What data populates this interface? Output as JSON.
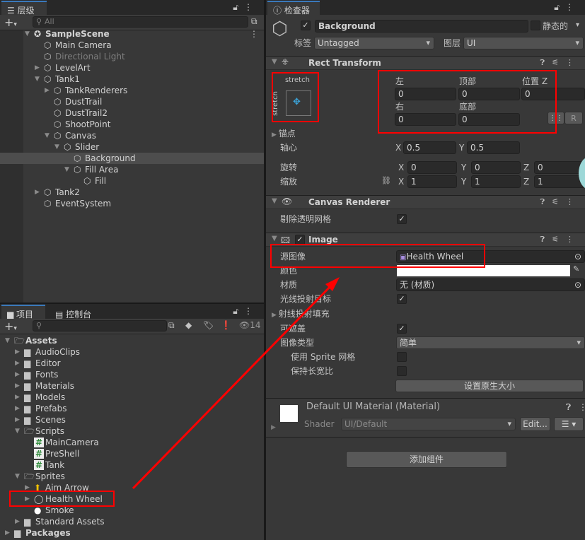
{
  "hierarchy": {
    "tab": "层级",
    "search_placeholder": "All",
    "items": [
      {
        "label": "SampleScene",
        "depth": 0,
        "arrow": "open",
        "icon": "unity-scene-icon",
        "bold": true
      },
      {
        "label": "Main Camera",
        "depth": 1,
        "arrow": "none",
        "icon": "gameobject-cube-icon"
      },
      {
        "label": "Directional Light",
        "depth": 1,
        "arrow": "none",
        "icon": "gameobject-cube-icon",
        "dim": true
      },
      {
        "label": "LevelArt",
        "depth": 1,
        "arrow": "closed",
        "icon": "gameobject-cube-icon"
      },
      {
        "label": "Tank1",
        "depth": 1,
        "arrow": "open",
        "icon": "gameobject-cube-icon"
      },
      {
        "label": "TankRenderers",
        "depth": 2,
        "arrow": "closed",
        "icon": "gameobject-cube-icon"
      },
      {
        "label": "DustTrail",
        "depth": 2,
        "arrow": "none",
        "icon": "gameobject-cube-icon"
      },
      {
        "label": "DustTrail2",
        "depth": 2,
        "arrow": "none",
        "icon": "gameobject-cube-icon"
      },
      {
        "label": "ShootPoint",
        "depth": 2,
        "arrow": "none",
        "icon": "gameobject-cube-icon"
      },
      {
        "label": "Canvas",
        "depth": 2,
        "arrow": "open",
        "icon": "gameobject-cube-icon"
      },
      {
        "label": "Slider",
        "depth": 3,
        "arrow": "open",
        "icon": "gameobject-cube-icon"
      },
      {
        "label": "Background",
        "depth": 4,
        "arrow": "none",
        "icon": "gameobject-cube-icon",
        "selected": true
      },
      {
        "label": "Fill Area",
        "depth": 4,
        "arrow": "open",
        "icon": "gameobject-cube-icon"
      },
      {
        "label": "Fill",
        "depth": 5,
        "arrow": "none",
        "icon": "gameobject-cube-icon"
      },
      {
        "label": "Tank2",
        "depth": 1,
        "arrow": "closed",
        "icon": "gameobject-cube-icon"
      },
      {
        "label": "EventSystem",
        "depth": 1,
        "arrow": "none",
        "icon": "gameobject-cube-icon"
      }
    ]
  },
  "project": {
    "tabs": [
      "项目",
      "控制台"
    ],
    "hidden_count": "14",
    "items": [
      {
        "label": "Assets",
        "depth": 0,
        "arrow": "open",
        "icon": "folder-open-icon",
        "bold": true
      },
      {
        "label": "AudioClips",
        "depth": 1,
        "arrow": "closed",
        "icon": "folder-icon"
      },
      {
        "label": "Editor",
        "depth": 1,
        "arrow": "closed",
        "icon": "folder-icon"
      },
      {
        "label": "Fonts",
        "depth": 1,
        "arrow": "closed",
        "icon": "folder-icon"
      },
      {
        "label": "Materials",
        "depth": 1,
        "arrow": "closed",
        "icon": "folder-icon"
      },
      {
        "label": "Models",
        "depth": 1,
        "arrow": "closed",
        "icon": "folder-icon"
      },
      {
        "label": "Prefabs",
        "depth": 1,
        "arrow": "closed",
        "icon": "folder-icon"
      },
      {
        "label": "Scenes",
        "depth": 1,
        "arrow": "closed",
        "icon": "folder-icon"
      },
      {
        "label": "Scripts",
        "depth": 1,
        "arrow": "open",
        "icon": "folder-open-icon"
      },
      {
        "label": "MainCamera",
        "depth": 2,
        "arrow": "none",
        "icon": "csharp-script-icon"
      },
      {
        "label": "PreShell",
        "depth": 2,
        "arrow": "none",
        "icon": "csharp-script-icon"
      },
      {
        "label": "Tank",
        "depth": 2,
        "arrow": "none",
        "icon": "csharp-script-icon"
      },
      {
        "label": "Sprites",
        "depth": 1,
        "arrow": "open",
        "icon": "folder-open-icon"
      },
      {
        "label": "Aim Arrow",
        "depth": 2,
        "arrow": "closed",
        "icon": "arrow-sprite-icon"
      },
      {
        "label": "Health Wheel",
        "depth": 2,
        "arrow": "closed",
        "icon": "ring-sprite-icon"
      },
      {
        "label": "Smoke",
        "depth": 2,
        "arrow": "none",
        "icon": "circle-sprite-icon"
      },
      {
        "label": "Standard Assets",
        "depth": 1,
        "arrow": "closed",
        "icon": "folder-icon"
      },
      {
        "label": "Packages",
        "depth": 0,
        "arrow": "closed",
        "icon": "folder-icon",
        "bold": true
      }
    ]
  },
  "inspector": {
    "tab": "检查器",
    "object_name": "Background",
    "active": true,
    "static_label": "静态的",
    "tag_label": "标签",
    "tag_value": "Untagged",
    "layer_label": "图层",
    "layer_value": "UI",
    "rect": {
      "title": "Rect Transform",
      "anchor_h": "stretch",
      "anchor_v": "stretch",
      "left_label": "左",
      "left": "0",
      "top_label": "顶部",
      "top": "0",
      "posz_label": "位置 Z",
      "posz": "0",
      "right_label": "右",
      "right": "0",
      "bottom_label": "底部",
      "bottom": "0",
      "r_button": "R",
      "anchors_label": "锚点",
      "pivot_label": "轴心",
      "pivot_x": "0.5",
      "pivot_y": "0.5",
      "rotation_label": "旋转",
      "rot_x": "0",
      "rot_y": "0",
      "rot_z": "0",
      "scale_label": "缩放",
      "scale_x": "1",
      "scale_y": "1",
      "scale_z": "1",
      "x": "X",
      "y": "Y",
      "z": "Z"
    },
    "canvas_renderer": {
      "title": "Canvas Renderer",
      "cull_label": "剔除透明网格",
      "cull": true
    },
    "image": {
      "title": "Image",
      "enabled": true,
      "source_label": "源图像",
      "source_value": "Health Wheel",
      "color_label": "颜色",
      "color": "#ffffff",
      "material_label": "材质",
      "material_value": "无 (材质)",
      "raycast_label": "光线投射目标",
      "raycast": true,
      "padding_label": "射线投射填充",
      "maskable_label": "可遮盖",
      "maskable": true,
      "type_label": "图像类型",
      "type_value": "简单",
      "sprite_mesh_label": "使用 Sprite 网格",
      "preserve_label": "保持长宽比",
      "native_size": "设置原生大小"
    },
    "material": {
      "name": "Default UI Material (Material)",
      "shader_label": "Shader",
      "shader_value": "UI/Default",
      "edit": "Edit..."
    },
    "add_component": "添加组件"
  },
  "colors": {
    "annotation": "#ff0000",
    "selection": "#4d4d4d",
    "panel": "#383838"
  }
}
